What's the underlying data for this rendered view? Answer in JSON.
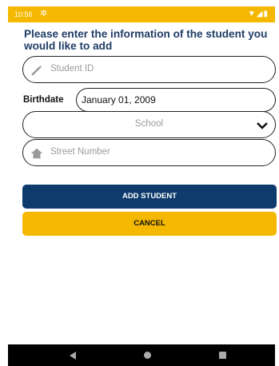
{
  "status": {
    "time": "10:56",
    "icons_right": "▼◢▮"
  },
  "header": {
    "title": "Please enter the information of the student you would like to add"
  },
  "form": {
    "student_id_placeholder": "Student ID",
    "birthdate_label": "Birthdate",
    "birthdate_value": "January 01, 2009",
    "school_placeholder": "School",
    "street_placeholder": "Street Number"
  },
  "buttons": {
    "add_label": "ADD STUDENT",
    "cancel_label": "CANCEL"
  },
  "colors": {
    "accent_yellow": "#f5b800",
    "navy": "#0e3b6b",
    "title_blue": "#1f3d66"
  }
}
